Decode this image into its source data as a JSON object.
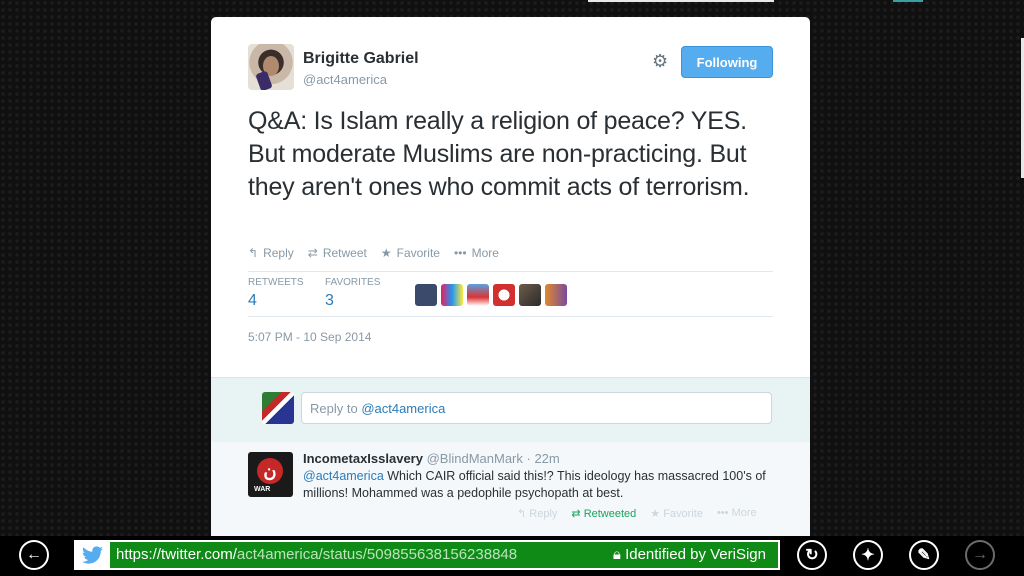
{
  "tweet": {
    "author_name": "Brigitte Gabriel",
    "author_handle": "@act4america",
    "follow_label": "Following",
    "text": "Q&A: Is Islam really a religion of peace? YES. But moderate Muslims are non-practicing. But they aren't ones who commit acts of terrorism.",
    "actions": {
      "reply": "Reply",
      "retweet": "Retweet",
      "favorite": "Favorite",
      "more": "More"
    },
    "stats": {
      "retweets_label": "RETWEETS",
      "retweets": "4",
      "favorites_label": "FAVORITES",
      "favorites": "3"
    },
    "timestamp": "5:07 PM - 10 Sep 2014"
  },
  "reply_box": {
    "prefix": "Reply to ",
    "mention": "@act4america"
  },
  "reply_tweet": {
    "name": "IncometaxIsslavery",
    "handle": "@BlindManMark",
    "separator": " · ",
    "time": "22m",
    "mention": "@act4america",
    "text": " Which CAIR official said this!? This ideology has massacred 100's of millions! Mohammed was a pedophile psychopath at best.",
    "actions": {
      "reply": "Reply",
      "retweeted": "Retweeted",
      "favorite": "Favorite",
      "more": "More"
    }
  },
  "browser": {
    "url_base": "https://twitter.com/",
    "url_path": "act4america/status/509855638156238848",
    "security": "Identified by VeriSign"
  },
  "colors": {
    "accent": "#55acee",
    "link": "#2b7bb9",
    "retweeted": "#19a35d",
    "urlbar": "#0f8a16"
  }
}
